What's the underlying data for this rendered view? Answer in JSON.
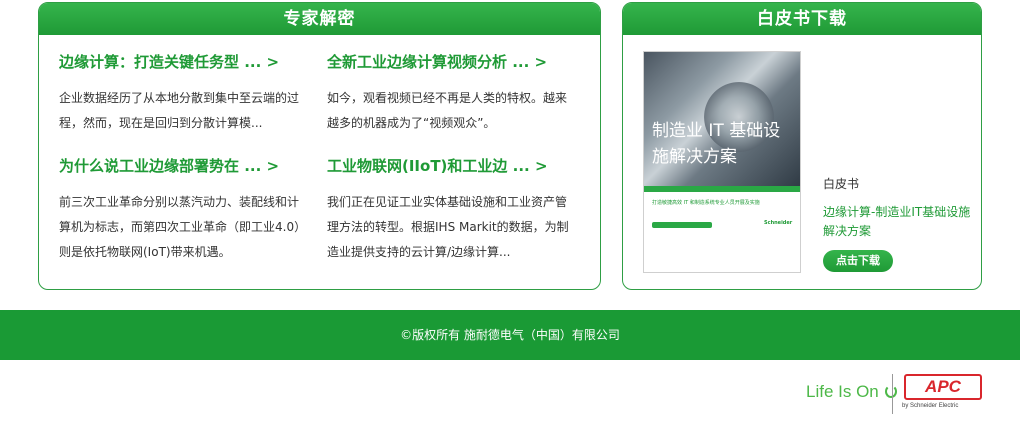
{
  "experts": {
    "heading": "专家解密",
    "articles": [
      {
        "title": "边缘计算：打造关键任务型 ... >",
        "desc": "企业数据经历了从本地分散到集中至云端的过程，然而，现在是回归到分散计算模..."
      },
      {
        "title": "全新工业边缘计算视频分析 ... >",
        "desc": "如今，观看视频已经不再是人类的特权。越来越多的机器成为了“视频观众”。"
      },
      {
        "title": "为什么说工业边缘部署势在 ... >",
        "desc": "前三次工业革命分别以蒸汽动力、装配线和计算机为标志，而第四次工业革命（即工业4.0）则是依托物联网(IoT)带来机遇。"
      },
      {
        "title": "工业物联网(IIoT)和工业边 ... >",
        "desc": "我们正在见证工业实体基础设施和工业资产管理方法的转型。根据IHS Markit的数据，为制造业提供支持的云计算/边缘计算..."
      }
    ]
  },
  "whitepaper": {
    "heading": "白皮书下载",
    "cover_title": "制造业 IT 基础设施解决方案",
    "cover_text": "打造敏捷高效 IT 和制造系统专业人员开展及实施",
    "cover_logo": "Schneider",
    "label": "白皮书",
    "link": "边缘计算-制造业IT基础设施解决方案",
    "button": "点击下载"
  },
  "footer": {
    "copyright": "©版权所有 施耐德电气（中国）有限公司"
  },
  "brand": {
    "tagline": "Life Is On",
    "apc": "APC",
    "byline": "by Schneider Electric"
  },
  "colors": {
    "accent": "#1f9a36",
    "apc_red": "#d9262c"
  }
}
